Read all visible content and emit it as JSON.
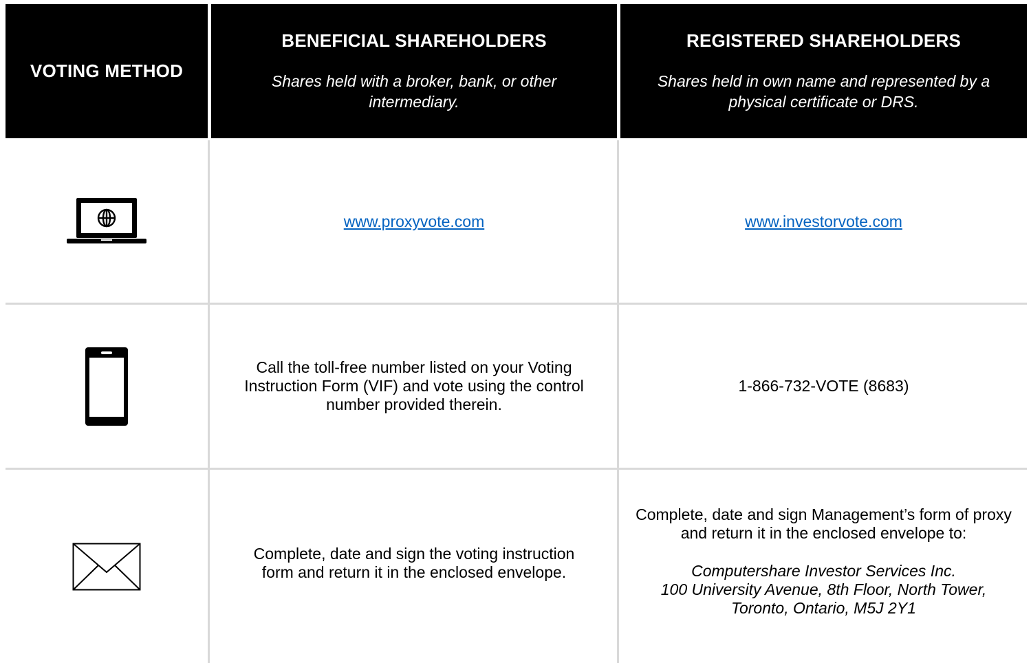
{
  "header": {
    "method": "VOTING METHOD",
    "beneficial_title": "BENEFICIAL SHAREHOLDERS",
    "beneficial_sub": "Shares held with a broker, bank, or other intermediary.",
    "registered_title": "REGISTERED SHAREHOLDERS",
    "registered_sub": "Shares held in own name and represented by a physical certificate or DRS."
  },
  "rows": [
    {
      "icon": "laptop-globe-icon",
      "beneficial": "www.proxyvote.com",
      "registered": "www.investorvote.com"
    },
    {
      "icon": "phone-icon",
      "beneficial": "Call the toll-free number listed on your Voting Instruction Form (VIF) and vote using the control number provided therein.",
      "registered": "1-866-732-VOTE (8683)"
    },
    {
      "icon": "envelope-icon",
      "beneficial": "Complete, date and sign the voting instruction form and return it in the enclosed envelope.",
      "registered": "Complete, date and sign Management’s form of proxy and return it in the enclosed envelope to:",
      "address": {
        "line1": "Computershare Investor Services Inc.",
        "line2": "100 University Avenue, 8th Floor, North Tower,",
        "line3": "Toronto, Ontario, M5J 2Y1"
      }
    }
  ]
}
